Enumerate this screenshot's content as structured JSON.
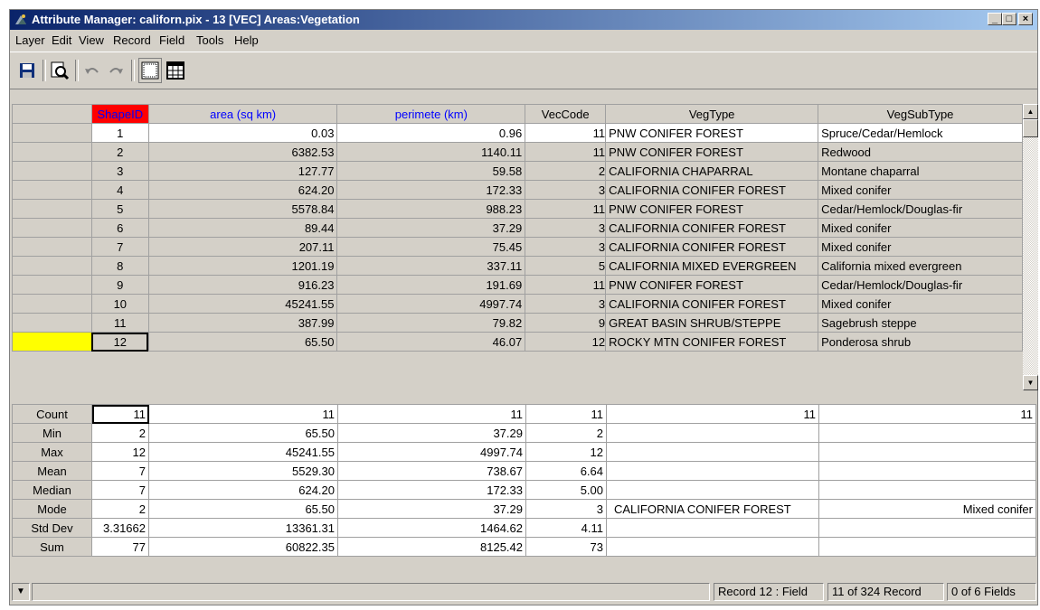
{
  "window": {
    "title": "Attribute Manager: californ.pix - 13 [VEC] Areas:Vegetation",
    "controls": [
      "_",
      "□",
      "×"
    ]
  },
  "menu": [
    "Layer",
    "Edit",
    "View",
    "Record",
    "Field",
    "Tools",
    "Help"
  ],
  "toolbar": {
    "icons": [
      "save-icon",
      "find-icon",
      "undo-icon",
      "redo-icon",
      "record-view-icon",
      "table-view-icon"
    ]
  },
  "grid": {
    "columns": [
      "ShapeID",
      "area (sq km)",
      "perimete (km)",
      "VecCode",
      "VegType",
      "VegSubType"
    ],
    "rows": [
      [
        "1",
        "0.03",
        "0.96",
        "11",
        "PNW CONIFER FOREST",
        "Spruce/Cedar/Hemlock"
      ],
      [
        "2",
        "6382.53",
        "1140.11",
        "11",
        "PNW CONIFER FOREST",
        "Redwood"
      ],
      [
        "3",
        "127.77",
        "59.58",
        "2",
        "CALIFORNIA CHAPARRAL",
        "Montane chaparral"
      ],
      [
        "4",
        "624.20",
        "172.33",
        "3",
        "CALIFORNIA CONIFER FOREST",
        "Mixed conifer"
      ],
      [
        "5",
        "5578.84",
        "988.23",
        "11",
        "PNW CONIFER FOREST",
        "Cedar/Hemlock/Douglas-fir"
      ],
      [
        "6",
        "89.44",
        "37.29",
        "3",
        "CALIFORNIA CONIFER FOREST",
        "Mixed conifer"
      ],
      [
        "7",
        "207.11",
        "75.45",
        "3",
        "CALIFORNIA CONIFER FOREST",
        "Mixed conifer"
      ],
      [
        "8",
        "1201.19",
        "337.11",
        "5",
        "CALIFORNIA MIXED EVERGREEN",
        "California mixed evergreen"
      ],
      [
        "9",
        "916.23",
        "191.69",
        "11",
        "PNW CONIFER FOREST",
        "Cedar/Hemlock/Douglas-fir"
      ],
      [
        "10",
        "45241.55",
        "4997.74",
        "3",
        "CALIFORNIA CONIFER FOREST",
        "Mixed conifer"
      ],
      [
        "11",
        "387.99",
        "79.82",
        "9",
        "GREAT BASIN SHRUB/STEPPE",
        "Sagebrush steppe"
      ],
      [
        "12",
        "65.50",
        "46.07",
        "12",
        "ROCKY MTN CONIFER FOREST",
        "Ponderosa shrub"
      ]
    ]
  },
  "stats": {
    "labels": [
      "Count",
      "Min",
      "Max",
      "Mean",
      "Median",
      "Mode",
      "Std Dev",
      "Sum"
    ],
    "rows": [
      [
        "11",
        "11",
        "11",
        "11",
        "11",
        "11"
      ],
      [
        "2",
        "65.50",
        "37.29",
        "2",
        "",
        ""
      ],
      [
        "12",
        "45241.55",
        "4997.74",
        "12",
        "",
        ""
      ],
      [
        "7",
        "5529.30",
        "738.67",
        "6.64",
        "",
        ""
      ],
      [
        "7",
        "624.20",
        "172.33",
        "5.00",
        "",
        ""
      ],
      [
        "2",
        "65.50",
        "37.29",
        "3",
        "CALIFORNIA CONIFER FOREST",
        "Mixed conifer"
      ],
      [
        "3.31662",
        "13361.31",
        "1464.62",
        "4.11",
        "",
        ""
      ],
      [
        "77",
        "60822.35",
        "8125.42",
        "73",
        "",
        ""
      ]
    ]
  },
  "status": {
    "record": "Record 12 : Field",
    "records": "11 of 324 Record",
    "fields": "0 of 6 Fields"
  },
  "colors": {
    "title_gradient_start": "#0a246a",
    "title_gradient_end": "#a6caf0",
    "selected_column_header": "#ff0000",
    "selected_row": "#ffff00",
    "column_header_text": "#0000ff"
  }
}
